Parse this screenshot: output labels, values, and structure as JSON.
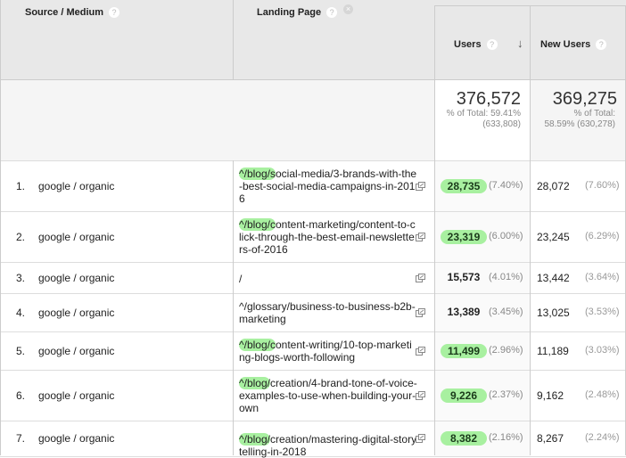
{
  "header": {
    "source_medium": "Source / Medium",
    "landing_page": "Landing Page",
    "users": "Users",
    "new_users": "New Users",
    "help_glyph": "?",
    "remove_glyph": "×",
    "sort_glyph": "↓"
  },
  "totals": {
    "users_value": "376,572",
    "users_sub1": "% of Total: 59.41%",
    "users_sub2": "(633,808)",
    "new_users_value": "369,275",
    "new_users_sub1": "% of Total:",
    "new_users_sub2": "58.59% (630,278)"
  },
  "rows": [
    {
      "index": "1.",
      "source": "google / organic",
      "lp_prefix": "^/blog/s",
      "lp_rest": "ocial-media/3-brands-with-the-best-social-media-campaigns-in-2016",
      "users": "28,735",
      "users_pct": "(7.40%)",
      "new_users": "28,072",
      "new_users_pct": "(7.60%)"
    },
    {
      "index": "2.",
      "source": "google / organic",
      "lp_prefix": "^/blog/c",
      "lp_rest": "ontent-marketing/content-to-click-through-the-best-email-newsletters-of-2016",
      "users": "23,319",
      "users_pct": "(6.00%)",
      "new_users": "23,245",
      "new_users_pct": "(6.29%)"
    },
    {
      "index": "3.",
      "source": "google / organic",
      "lp_prefix": "",
      "lp_rest": "/",
      "users": "15,573",
      "users_pct": "(4.01%)",
      "new_users": "13,442",
      "new_users_pct": "(3.64%)"
    },
    {
      "index": "4.",
      "source": "google / organic",
      "lp_prefix": "",
      "lp_rest": "^/glossary/business-to-business-b2b-marketing",
      "users": "13,389",
      "users_pct": "(3.45%)",
      "new_users": "13,025",
      "new_users_pct": "(3.53%)"
    },
    {
      "index": "5.",
      "source": "google / organic",
      "lp_prefix": "^/blog/c",
      "lp_rest": "ontent-writing/10-top-marketing-blogs-worth-following",
      "users": "11,499",
      "users_pct": "(2.96%)",
      "new_users": "11,189",
      "new_users_pct": "(3.03%)"
    },
    {
      "index": "6.",
      "source": "google / organic",
      "lp_prefix": "^/blog/",
      "lp_rest": "creation/4-brand-tone-of-voice-examples-to-use-when-building-your-own",
      "users": "9,226",
      "users_pct": "(2.37%)",
      "new_users": "9,162",
      "new_users_pct": "(2.48%)"
    },
    {
      "index": "7.",
      "source": "google / organic",
      "lp_prefix": "^/blog/",
      "lp_rest": "creation/mastering-digital-storytelling-in-2018",
      "users": "8,382",
      "users_pct": "(2.16%)",
      "new_users": "8,267",
      "new_users_pct": "(2.24%)"
    }
  ],
  "colors": {
    "highlight": "#a8f0a0",
    "header_bg": "#e8e8e8"
  }
}
